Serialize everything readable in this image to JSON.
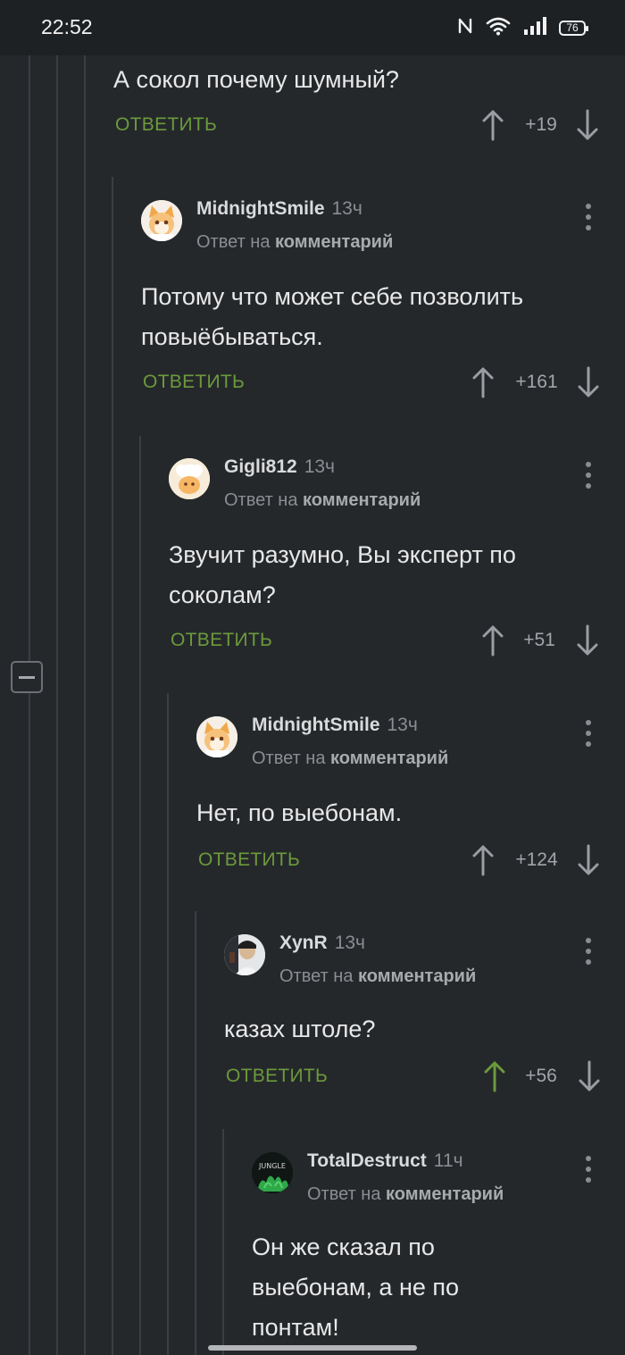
{
  "status_bar": {
    "time": "22:52",
    "battery": "76"
  },
  "thread": {
    "top_comment": {
      "text": "А сокол почему шумный?",
      "reply_label": "ОТВЕТИТЬ",
      "score": "+19"
    },
    "comments": [
      {
        "author": "MidnightSmile",
        "time": "13ч",
        "reply_prefix": "Ответ на",
        "reply_target": "комментарий",
        "text_lines": [
          "Потому что может себе позволить",
          "повыёбываться."
        ],
        "reply_label": "ОТВЕТИТЬ",
        "score": "+161",
        "upvoted": false
      },
      {
        "author": "Gigli812",
        "time": "13ч",
        "reply_prefix": "Ответ на",
        "reply_target": "комментарий",
        "text_lines": [
          "Звучит разумно, Вы эксперт по",
          "соколам?"
        ],
        "reply_label": "ОТВЕТИТЬ",
        "score": "+51",
        "upvoted": false
      },
      {
        "author": "MidnightSmile",
        "time": "13ч",
        "reply_prefix": "Ответ на",
        "reply_target": "комментарий",
        "text_lines": [
          "Нет, по выебонам."
        ],
        "reply_label": "ОТВЕТИТЬ",
        "score": "+124",
        "upvoted": false
      },
      {
        "author": "XynR",
        "time": "13ч",
        "reply_prefix": "Ответ на",
        "reply_target": "комментарий",
        "text_lines": [
          "казах штоле?"
        ],
        "reply_label": "ОТВЕТИТЬ",
        "score": "+56",
        "upvoted": true
      },
      {
        "author": "TotalDestruct",
        "time": "11ч",
        "reply_prefix": "Ответ на",
        "reply_target": "комментарий",
        "text_lines": [
          "Он же сказал по",
          "выебонам, а не по",
          "понтам!"
        ],
        "avatar_text": "JUNGLE"
      }
    ]
  },
  "colors": {
    "background": "#25282b",
    "reply_green": "#6b9a3c",
    "upvoted_green": "#6b9a3c",
    "muted_text": "#8a8e92"
  },
  "icons": {
    "nfc": "nfc-icon",
    "wifi": "wifi-icon",
    "signal": "signal-icon",
    "battery": "battery-icon",
    "upvote": "arrow-up-icon",
    "downvote": "arrow-down-icon",
    "menu": "more-vertical-icon",
    "collapse": "minus-icon"
  }
}
